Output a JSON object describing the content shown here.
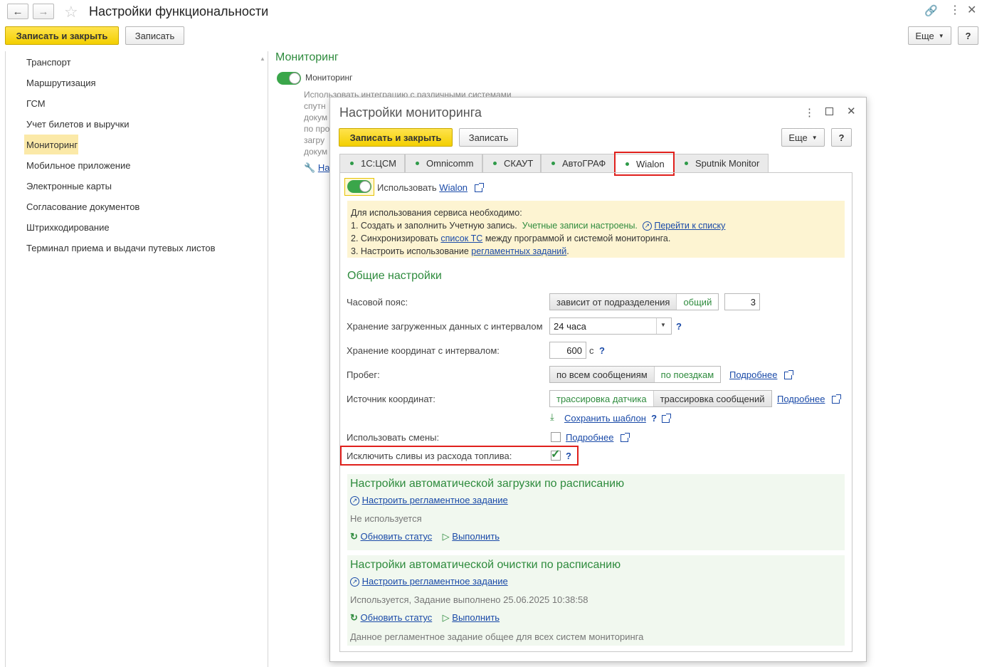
{
  "window": {
    "title": "Настройки функциональности"
  },
  "toolbar": {
    "save_close": "Записать и закрыть",
    "save": "Записать",
    "more": "Еще",
    "help": "?"
  },
  "sidebar": {
    "items": [
      {
        "label": "Транспорт"
      },
      {
        "label": "Маршрутизация"
      },
      {
        "label": "ГСМ"
      },
      {
        "label": "Учет билетов и выручки"
      },
      {
        "label": "Мониторинг"
      },
      {
        "label": "Мобильное приложение"
      },
      {
        "label": "Электронные карты"
      },
      {
        "label": "Согласование документов"
      },
      {
        "label": "Штрихкодирование"
      },
      {
        "label": "Терминал приема и выдачи путевых листов"
      }
    ]
  },
  "main": {
    "section_title": "Мониторинг",
    "toggle_label": "Мониторинг",
    "description_lines": [
      "Использовать интеграцию с различными системами",
      "спутн",
      "докум",
      "по про",
      "загру",
      "докум"
    ],
    "link_fragment": "На"
  },
  "dialog": {
    "title": "Настройки мониторинга",
    "save_close": "Записать и закрыть",
    "save": "Записать",
    "more": "Еще",
    "help": "?",
    "tabs": [
      {
        "label": "1С:ЦСМ"
      },
      {
        "label": "Omnicomm"
      },
      {
        "label": "СКАУТ"
      },
      {
        "label": "АвтоГРАФ"
      },
      {
        "label": "Wialon"
      },
      {
        "label": "Sputnik Monitor"
      }
    ],
    "use_label": "Использовать",
    "use_link": "Wialon",
    "info": {
      "line0": "Для использования сервиса необходимо:",
      "line1": "1. Создать и заполнить Учетную запись.",
      "line1_status": "Учетные записи настроены.",
      "line1_link": "Перейти к списку",
      "line2_pre": "2. Синхронизировать",
      "line2_link": "список ТС",
      "line2_post": "между программой и системой мониторинга.",
      "line3_pre": "3. Настроить использование",
      "line3_link": "регламентных заданий",
      "line3_post": "."
    },
    "general_title": "Общие настройки",
    "tz_label": "Часовой пояс:",
    "tz_opt1": "зависит от подразделения",
    "tz_opt2": "общий",
    "tz_value": "3",
    "storage_label": "Хранение загруженных данных с интервалом",
    "storage_value": "24 часа",
    "coords_label": "Хранение координат с интервалом:",
    "coords_value": "600",
    "coords_unit": "с",
    "mileage_label": "Пробег:",
    "mileage_opt1": "по всем сообщениям",
    "mileage_opt2": "по поездкам",
    "more_link": "Подробнее",
    "source_label": "Источник координат:",
    "source_opt1": "трассировка датчика",
    "source_opt2": "трассировка сообщений",
    "save_template": "Сохранить шаблон",
    "shifts_label": "Использовать смены:",
    "exclude_label": "Исключить сливы из расхода топлива:",
    "q": "?",
    "auto_load": {
      "title": "Настройки автоматической загрузки по расписанию",
      "configure": "Настроить регламентное задание",
      "status": "Не используется",
      "refresh": "Обновить статус",
      "run": "Выполнить"
    },
    "auto_clean": {
      "title": "Настройки автоматической очистки по расписанию",
      "configure": "Настроить регламентное задание",
      "status": "Используется, Задание выполнено 25.06.2025 10:38:58",
      "refresh": "Обновить статус",
      "run": "Выполнить",
      "note": "Данное регламентное задание общее для всех систем мониторинга"
    }
  },
  "colors": {
    "accent_green": "#2e8b3d",
    "highlight_red": "#e0201c",
    "button_yellow": "#f5d400",
    "info_bg": "#fdf4d2",
    "schedule_bg": "#f1f8ef"
  }
}
